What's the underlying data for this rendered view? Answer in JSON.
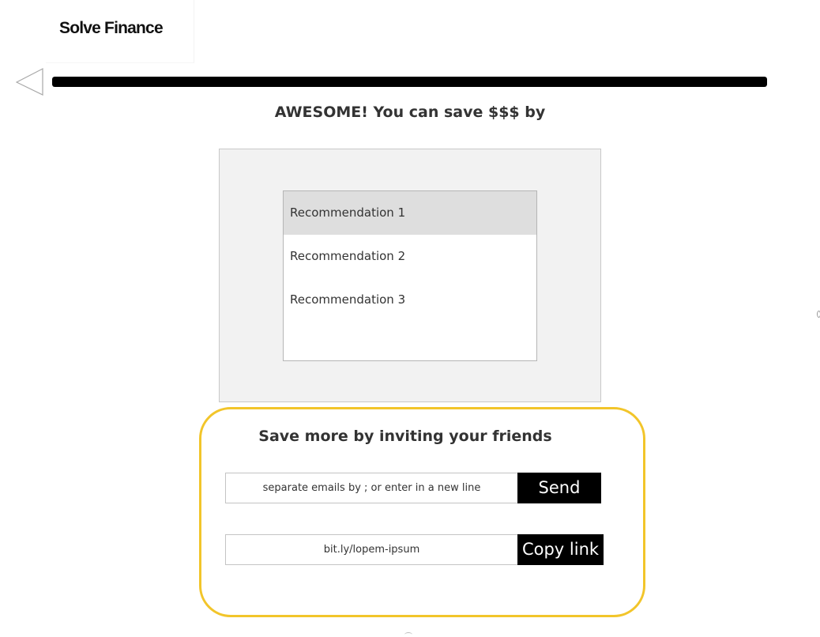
{
  "header": {
    "brand": "Solve Finance"
  },
  "progress": {
    "percent": 100
  },
  "headline": "AWESOME! You can save $$$ by",
  "recommendations": {
    "selected_index": 0,
    "items": [
      {
        "label": "Recommendation 1"
      },
      {
        "label": "Recommendation 2"
      },
      {
        "label": "Recommendation 3"
      }
    ]
  },
  "invite": {
    "title": "Save more by inviting your friends",
    "email_placeholder": "separate emails by ; or enter in a new line",
    "email_value": "",
    "send_label": "Send",
    "link_value": "bit.ly/lopem-ipsum",
    "copy_label": "Copy link"
  },
  "colors": {
    "accent_border": "#f2c52a",
    "button_bg": "#000000",
    "button_text": "#ffffff",
    "panel_bg": "#f2f2f2",
    "selected_item_bg": "#dedede"
  },
  "icons": {
    "back": "back-arrow-icon"
  }
}
